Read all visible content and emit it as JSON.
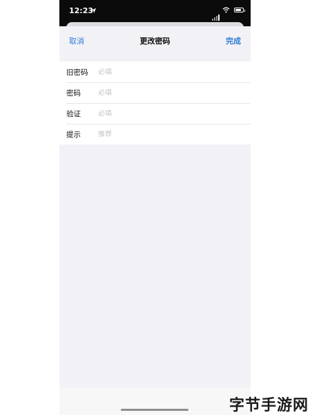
{
  "status_bar": {
    "time": "12:23"
  },
  "nav": {
    "cancel_label": "取消",
    "title": "更改密码",
    "done_label": "完成"
  },
  "form": {
    "rows": [
      {
        "label": "旧密码",
        "placeholder": "必填"
      },
      {
        "label": "密码",
        "placeholder": "必填"
      },
      {
        "label": "验证",
        "placeholder": "必填"
      },
      {
        "label": "提示",
        "placeholder": "推荐"
      }
    ]
  },
  "watermark": {
    "text": "字节手游网"
  },
  "colors": {
    "accent": "#2f7bd8",
    "background": "#f2f2f6",
    "status_bar": "#0b0b0b"
  }
}
